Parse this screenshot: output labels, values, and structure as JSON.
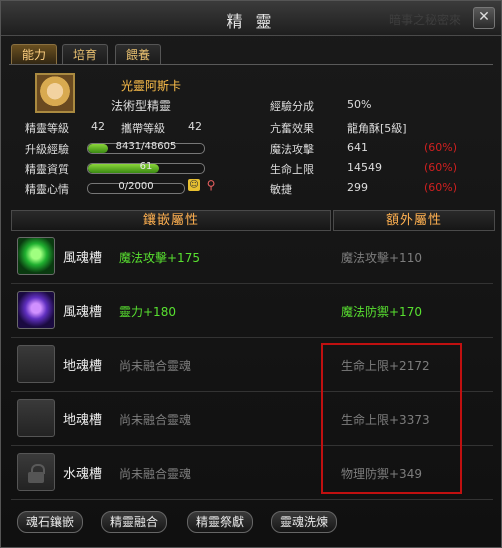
{
  "window": {
    "title": "精 靈",
    "ghost_title": "暗事之秘密來",
    "close": "✕"
  },
  "tabs": [
    "能力",
    "培育",
    "餵養"
  ],
  "spirit": {
    "name": "光靈阿斯卡",
    "type": "法術型精靈",
    "left_stats": {
      "spirit_level_label": "精靈等級",
      "spirit_level": "42",
      "carry_level_label": "攜帶等級",
      "carry_level": "42",
      "exp_label": "升級經驗",
      "exp_text": "8431/48605",
      "exp_fraction": 0.17,
      "aptitude_label": "精靈資質",
      "aptitude_text": "61",
      "aptitude_fraction": 0.61,
      "mood_label": "精靈心情",
      "mood_text": "0/2000",
      "mood_fraction": 0.0,
      "mood_icon": "smile-face-icon",
      "wand_icon": "magic-wand-icon"
    },
    "right_stats": [
      {
        "label": "經驗分成",
        "value": "50%",
        "pct": ""
      },
      {
        "label": "亢奮效果",
        "value": "龍角酥[5級]",
        "pct": ""
      },
      {
        "label": "魔法攻擊",
        "value": "641",
        "pct": "(60%)"
      },
      {
        "label": "生命上限",
        "value": "14549",
        "pct": "(60%)"
      },
      {
        "label": "敏捷",
        "value": "299",
        "pct": "(60%)"
      }
    ]
  },
  "headers": {
    "inlay": "鑲嵌屬性",
    "extra": "額外屬性"
  },
  "slots": [
    {
      "gem": "wind-soul-gem-icon",
      "name": "風魂槽",
      "attr": "魔法攻擊+175",
      "extra": "魔法攻擊+110"
    },
    {
      "gem": "spirit-soul-gem-icon",
      "name": "風魂槽",
      "attr": "靈力+180",
      "extra": "魔法防禦+170"
    },
    {
      "gem": "empty-slot-icon",
      "name": "地魂槽",
      "attr": "尚未融合靈魂",
      "extra": "生命上限+2172"
    },
    {
      "gem": "empty-slot-icon",
      "name": "地魂槽",
      "attr": "尚未融合靈魂",
      "extra": "生命上限+3373"
    },
    {
      "gem": "lock-icon",
      "name": "水魂槽",
      "attr": "尚未融合靈魂",
      "extra": "物理防禦+349"
    }
  ],
  "buttons": [
    "魂石鑲嵌",
    "精靈融合",
    "精靈祭獻",
    "靈魂洗煉"
  ],
  "colors": {
    "gold": "#ffc04a",
    "green": "#58e030",
    "red": "#d02020",
    "highlight_box": "#c01010"
  }
}
